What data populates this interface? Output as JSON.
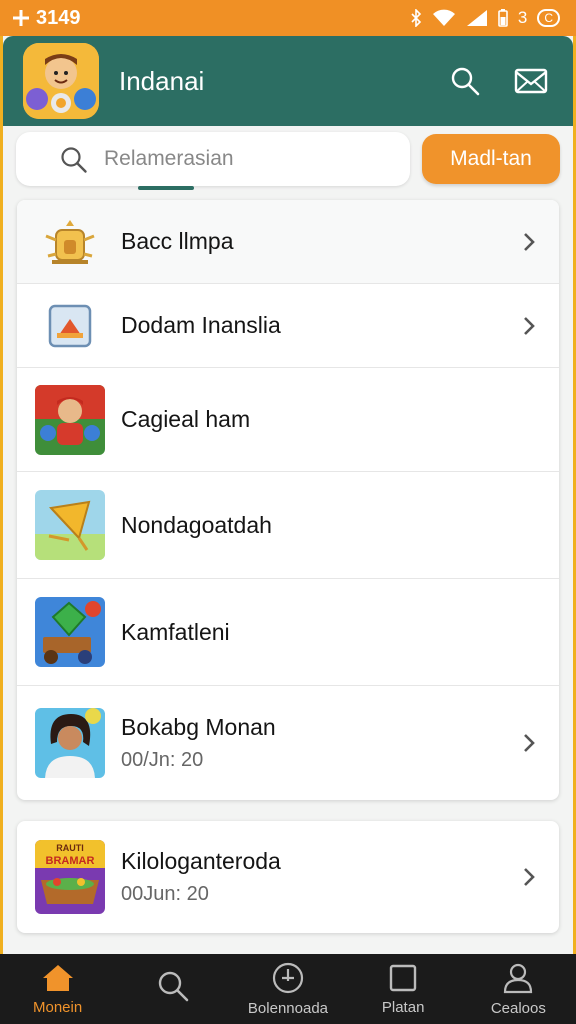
{
  "status_bar": {
    "time": "3149",
    "battery_text": "3",
    "battery_pill": "C"
  },
  "app_bar": {
    "title": "Indanai",
    "icons": [
      "search-icon",
      "mail-icon"
    ]
  },
  "search": {
    "placeholder": "Relamerasian",
    "action_label": "Madl-tan"
  },
  "list": {
    "items": [
      {
        "title": "Bacc llmpa",
        "subtitle": "",
        "icon": "shrine-icon",
        "chevron": true
      },
      {
        "title": "Dodam Inanslia",
        "subtitle": "",
        "icon": "picture-frame-icon",
        "chevron": true
      },
      {
        "title": "Cagieal ham",
        "subtitle": "",
        "icon": "game-character-icon",
        "chevron": false
      },
      {
        "title": "Nondagoatdah",
        "subtitle": "",
        "icon": "kite-icon",
        "chevron": false
      },
      {
        "title": "Kamfatleni",
        "subtitle": "",
        "icon": "gem-cart-icon",
        "chevron": false
      },
      {
        "title": "Bokabg Monan",
        "subtitle": "00/Jn: 20",
        "icon": "woman-avatar-icon",
        "chevron": true
      }
    ]
  },
  "featured": {
    "title": "Kilologanteroda",
    "subtitle": "00Jun: 20",
    "badge_line1": "RAUTI",
    "badge_line2": "BRAMAR",
    "icon": "game-banner-icon",
    "chevron": true
  },
  "bottom_nav": {
    "items": [
      {
        "label": "Monein",
        "icon": "home-icon",
        "active": true
      },
      {
        "label": "",
        "icon": "search-icon",
        "active": false
      },
      {
        "label": "Bolennoada",
        "icon": "download-icon",
        "active": false
      },
      {
        "label": "Platan",
        "icon": "square-icon",
        "active": false
      },
      {
        "label": "Cealoos",
        "icon": "person-icon",
        "active": false
      }
    ]
  },
  "colors": {
    "status_bar": "#f09025",
    "app_bar": "#2c6e63",
    "accent": "#f0932b",
    "nav_bg": "#1b1b1b"
  }
}
